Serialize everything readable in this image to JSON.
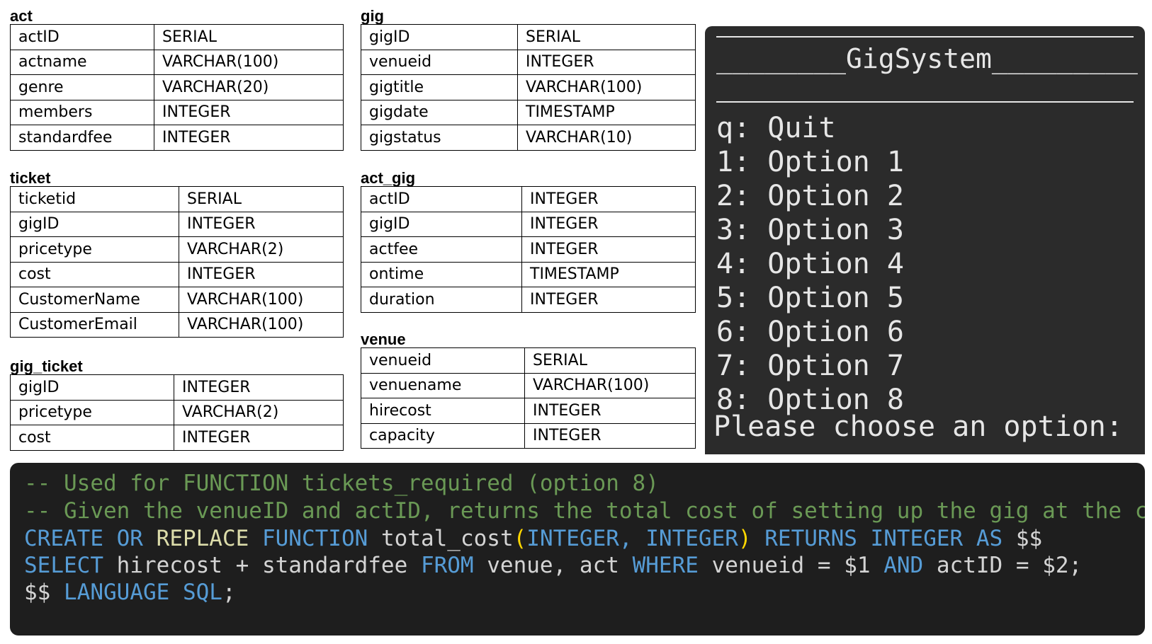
{
  "tables": {
    "act": {
      "title": "act",
      "rows": [
        {
          "name": "actID",
          "type": "SERIAL"
        },
        {
          "name": "actname",
          "type": "VARCHAR(100)"
        },
        {
          "name": "genre",
          "type": "VARCHAR(20)"
        },
        {
          "name": "members",
          "type": "INTEGER"
        },
        {
          "name": "standardfee",
          "type": "INTEGER"
        }
      ]
    },
    "gig": {
      "title": "gig",
      "rows": [
        {
          "name": "gigID",
          "type": "SERIAL"
        },
        {
          "name": "venueid",
          "type": "INTEGER"
        },
        {
          "name": "gigtitle",
          "type": "VARCHAR(100)"
        },
        {
          "name": "gigdate",
          "type": "TIMESTAMP"
        },
        {
          "name": "gigstatus",
          "type": "VARCHAR(10)"
        }
      ]
    },
    "ticket": {
      "title": "ticket",
      "rows": [
        {
          "name": "ticketid",
          "type": "SERIAL"
        },
        {
          "name": "gigID",
          "type": "INTEGER"
        },
        {
          "name": "pricetype",
          "type": "VARCHAR(2)"
        },
        {
          "name": "cost",
          "type": "INTEGER"
        },
        {
          "name": "CustomerName",
          "type": "VARCHAR(100)"
        },
        {
          "name": "CustomerEmail",
          "type": "VARCHAR(100)"
        }
      ]
    },
    "act_gig": {
      "title": "act_gig",
      "rows": [
        {
          "name": "actID",
          "type": "INTEGER"
        },
        {
          "name": "gigID",
          "type": "INTEGER"
        },
        {
          "name": "actfee",
          "type": "INTEGER"
        },
        {
          "name": "ontime",
          "type": "TIMESTAMP"
        },
        {
          "name": "duration",
          "type": "INTEGER"
        }
      ]
    },
    "gig_ticket": {
      "title": "gig_ticket",
      "rows": [
        {
          "name": "gigID",
          "type": "INTEGER"
        },
        {
          "name": "pricetype",
          "type": "VARCHAR(2)"
        },
        {
          "name": "cost",
          "type": "INTEGER"
        }
      ]
    },
    "venue": {
      "title": "venue",
      "rows": [
        {
          "name": "venueid",
          "type": "SERIAL"
        },
        {
          "name": "venuename",
          "type": "VARCHAR(100)"
        },
        {
          "name": "hirecost",
          "type": "INTEGER"
        },
        {
          "name": "capacity",
          "type": "INTEGER"
        }
      ]
    }
  },
  "terminal": {
    "title": "________GigSystem_________",
    "menu": [
      "q: Quit",
      "1: Option 1",
      "2: Option 2",
      "3: Option 3",
      "4: Option 4",
      "5: Option 5",
      "6: Option 6",
      "7: Option 7",
      "8: Option 8"
    ],
    "prompt": "Please choose an option:"
  },
  "code": {
    "comment_1": "-- Used for FUNCTION tickets_required (option 8)",
    "comment_2": "-- Given the venueID and actID, returns the total cost of setting up the gig at the corre",
    "l3_create": "CREATE OR",
    "l3_replace": "REPLACE",
    "l3_function": "FUNCTION",
    "l3_name": "total_cost",
    "l3_open": "(",
    "l3_args": "INTEGER, INTEGER",
    "l3_close": ")",
    "l3_returns": "RETURNS INTEGER AS",
    "l3_dollar": "$$",
    "l4_select": "SELECT",
    "l4_expr": "hirecost + standardfee",
    "l4_from": "FROM",
    "l4_tables": "venue, act",
    "l4_where": "WHERE",
    "l4_cond1": "venueid = $1",
    "l4_and": "AND",
    "l4_cond2": "actID = $2;",
    "l5_dollar": "$$",
    "l5_language": "LANGUAGE SQL",
    "l5_semi": ";",
    "colors": {
      "comment": "#6a9955",
      "keyword": "#569cd6",
      "function": "#dcdcaa",
      "identifier": "#d4d4d4",
      "bracket": "#ffd700"
    }
  }
}
